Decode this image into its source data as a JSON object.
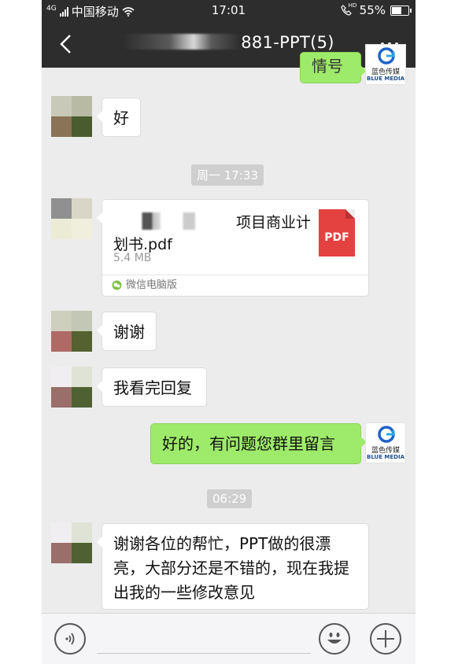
{
  "status_bar": {
    "network": "4G",
    "carrier": "中国移动",
    "time": "17:01",
    "hd_label": "HD",
    "battery_percent": "55%",
    "battery_level": 0.55
  },
  "nav": {
    "title_suffix": "881-PPT(5)"
  },
  "brand": {
    "name_cn": "蓝色传媒",
    "name_en": "BLUE MEDIA"
  },
  "messages": {
    "top_partial": "情号",
    "m1": "好",
    "ts1": "周一 17:33",
    "file": {
      "name_part1": "项目商业计",
      "name_part2": "划书.pdf",
      "size": "5.4 MB",
      "badge": "PDF",
      "source": "微信电脑版"
    },
    "m2": "谢谢",
    "m3": "我看完回复",
    "m4": "好的，有问题您群里留言",
    "ts2": "06:29",
    "m5": "谢谢各位的帮忙，PPT做的很漂亮，大部分还是不错的，现在我提出我的一些修改意见"
  },
  "colors": {
    "bar_dark": "#2d2d2d",
    "chat_bg": "#ececec",
    "bubble_green": "#9eea6a",
    "pdf_red": "#e44141"
  },
  "icons": [
    "back-arrow-icon",
    "more-icon",
    "wifi-icon",
    "phone-hd-icon",
    "battery-icon",
    "pdf-icon",
    "wechat-icon",
    "voice-icon",
    "emoji-icon",
    "plus-icon"
  ]
}
